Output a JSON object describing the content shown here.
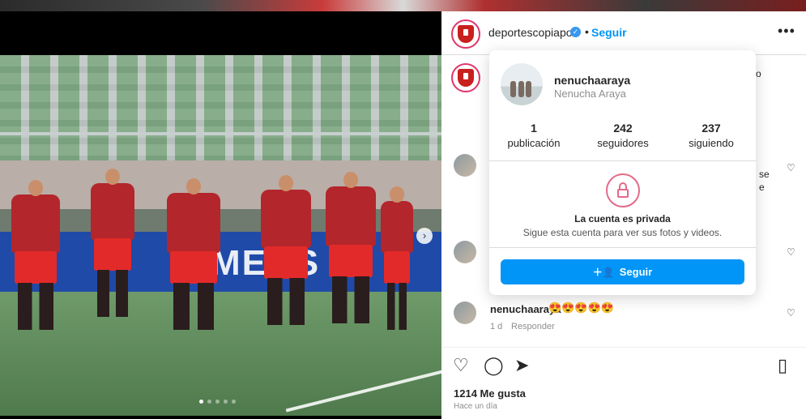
{
  "post": {
    "carousel_dots": 5,
    "active_dot": 0,
    "banner_text": "MEDS"
  },
  "header": {
    "username": "deportescopiapo",
    "verified_icon": "verified-badge-icon",
    "dot": "•",
    "follow_label": "Seguir",
    "more_label": "•••"
  },
  "popup": {
    "username": "nenuchaaraya",
    "full_name": "Nenucha Araya",
    "stats": [
      {
        "value": "1",
        "label": "publicación"
      },
      {
        "value": "242",
        "label": "seguidores"
      },
      {
        "value": "237",
        "label": "siguiendo"
      }
    ],
    "private_title": "La cuenta es privada",
    "private_sub": "Sigue esta cuenta para ver sus fotos y videos.",
    "follow_button": "Seguir"
  },
  "comment": {
    "username": "nenuchaaraya",
    "text": "😍😍😍😍😍",
    "time": "1 d",
    "reply": "Responder"
  },
  "fragments": {
    "o_right": "o",
    "se": "se",
    "e": "e"
  },
  "footer": {
    "likes": "1214 Me gusta",
    "when": "Hace un día"
  },
  "colors": {
    "accent": "#0095f6",
    "club_red": "#c8201f"
  }
}
